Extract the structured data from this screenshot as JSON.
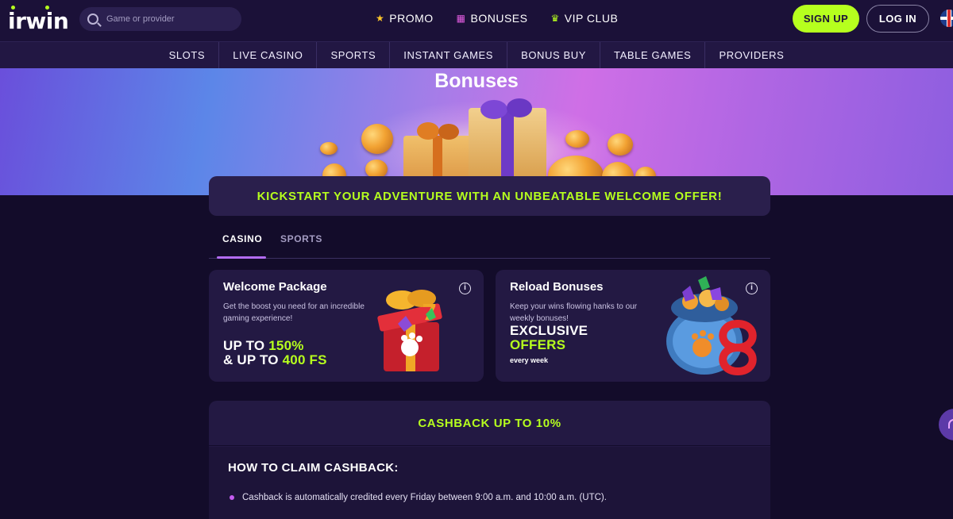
{
  "header": {
    "logo": "irwin",
    "search_placeholder": "Game or provider",
    "nav": [
      {
        "label": "PROMO",
        "icon": "star-icon"
      },
      {
        "label": "BONUSES",
        "icon": "gift-icon"
      },
      {
        "label": "VIP CLUB",
        "icon": "crown-icon"
      }
    ],
    "signup_label": "SIGN UP",
    "login_label": "LOG IN",
    "language_icon": "uk-flag-icon",
    "accent_color": "#b6ff1e"
  },
  "categories": [
    "SLOTS",
    "LIVE CASINO",
    "SPORTS",
    "INSTANT GAMES",
    "BONUS BUY",
    "TABLE GAMES",
    "PROVIDERS"
  ],
  "hero": {
    "title": "Bonuses"
  },
  "banner": {
    "text": "KICKSTART YOUR ADVENTURE WITH AN UNBEATABLE WELCOME OFFER!"
  },
  "tabs": [
    {
      "label": "CASINO",
      "active": true
    },
    {
      "label": "SPORTS",
      "active": false
    }
  ],
  "cards": {
    "welcome": {
      "title": "Welcome Package",
      "desc": "Get the boost you need for an incredible gaming experience!",
      "line1_prefix": "UP TO ",
      "line1_value": "150%",
      "line2_prefix": "& UP TO ",
      "line2_value": "400 FS"
    },
    "reload": {
      "title": "Reload Bonuses",
      "desc": "Keep your wins flowing hanks to our weekly bonuses!",
      "line1": "EXCLUSIVE",
      "line2": "OFFERS",
      "note": "every week"
    }
  },
  "cashback": {
    "title": "CASHBACK UP TO 10%",
    "claim_title": "HOW TO CLAIM CASHBACK:",
    "bullets": [
      "Cashback is automatically credited every Friday between 9:00 a.m. and 10:00 a.m. (UTC)."
    ]
  }
}
